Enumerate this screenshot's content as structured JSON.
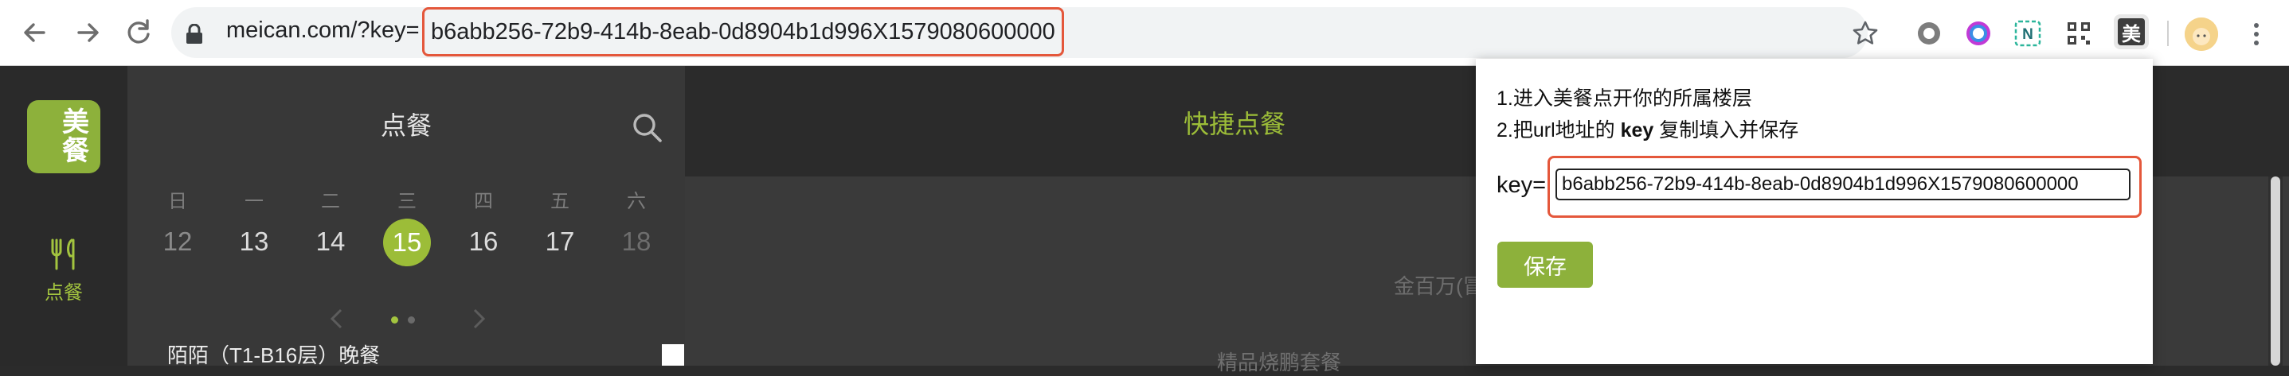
{
  "browser": {
    "url_host": "meican.com/?key=",
    "url_key": "b6abb256-72b9-414b-8eab-0d8904b1d996X1579080600000",
    "extension_label": "美",
    "accent_highlight": "#e4573b"
  },
  "rail": {
    "logo_line1": "美",
    "logo_line2": "餐",
    "item_label": "点餐",
    "item_icon": "fork-knife-icon",
    "brand_color": "#8db13b"
  },
  "panel": {
    "title": "点餐",
    "weekdays": [
      "日",
      "一",
      "二",
      "三",
      "四",
      "五",
      "六"
    ],
    "dates": [
      "12",
      "13",
      "14",
      "15",
      "16",
      "17",
      "18"
    ],
    "selected_date": "15",
    "restaurant": "陌陌（T1-B16层）晚餐"
  },
  "content": {
    "title": "快捷点餐",
    "faded_text_1": "金百万(冒",
    "faded_text_2": "精品烧鹏套餐"
  },
  "popup": {
    "line1": "1.进入美餐点开你的所属楼层",
    "line2_prefix": "2.把url地址的 ",
    "line2_key": "key",
    "line2_suffix": " 复制填入并保存",
    "key_label": "key=",
    "key_value": "b6abb256-72b9-414b-8eab-0d8904b1d996X1579080600000",
    "save_label": "保存"
  }
}
